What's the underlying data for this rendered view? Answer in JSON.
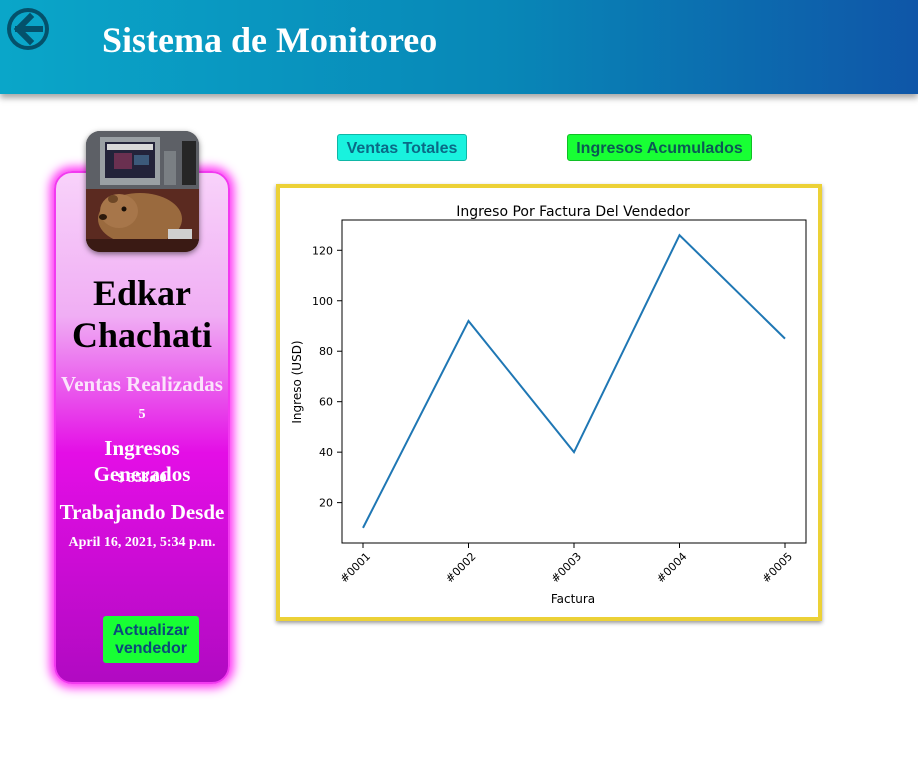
{
  "header": {
    "title": "Sistema de Monitoreo",
    "back_icon": "arrow-left-icon"
  },
  "profile": {
    "avatar_icon": "capybara-photo",
    "name_first": "Edkar",
    "name_last": "Chachati",
    "sales_label": "Ventas Realizadas",
    "sales_value": "5",
    "income_label": "Ingresos Generados",
    "income_value": "$ 353.00",
    "since_label": "Trabajando Desde",
    "since_value": "April 16, 2021, 5:34 p.m.",
    "update_button_line1": "Actualizar",
    "update_button_line2": "vendedor"
  },
  "tabs": {
    "total_sales": "Ventas Totales",
    "accumulated_income": "Ingresos Acumulados"
  },
  "colors": {
    "header_start": "#0aa6c9",
    "header_end": "#0f56a8",
    "card_glow": "#ff31f6",
    "button_green": "#18ff34",
    "button_cyan": "#19f2de",
    "chart_border": "#ecd136",
    "series_line": "#1f77b4"
  },
  "chart_data": {
    "type": "line",
    "title": "Ingreso Por Factura Del Vendedor",
    "xlabel": "Factura",
    "ylabel": "Ingreso (USD)",
    "categories": [
      "#0001",
      "#0002",
      "#0003",
      "#0004",
      "#0005"
    ],
    "values": [
      10,
      92,
      40,
      126,
      85
    ],
    "yticks": [
      20,
      40,
      60,
      80,
      100,
      120
    ],
    "ylim": [
      4,
      132
    ],
    "grid": false
  }
}
